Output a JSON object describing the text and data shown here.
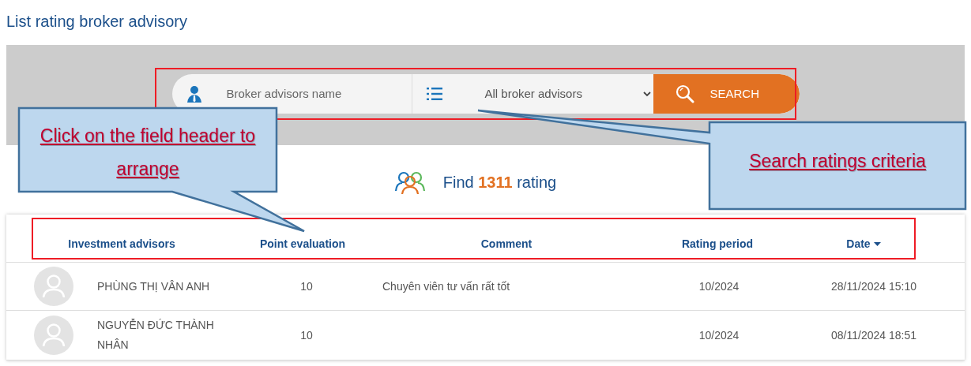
{
  "title": "List rating broker advisory",
  "search": {
    "name_placeholder": "Broker advisors name",
    "filter_value": "All broker advisors",
    "button": "SEARCH"
  },
  "summary": {
    "prefix": "Find",
    "count": "1311",
    "suffix": "rating"
  },
  "table": {
    "columns": [
      {
        "label": "Investment advisors",
        "sorted": false
      },
      {
        "label": "Point evaluation",
        "sorted": false
      },
      {
        "label": "Comment",
        "sorted": false
      },
      {
        "label": "Rating period",
        "sorted": false
      },
      {
        "label": "Date",
        "sorted": true
      }
    ],
    "rows": [
      {
        "name": "PHÙNG THỊ VÂN ANH",
        "point": "10",
        "comment": "Chuyên viên tư vấn rất tốt",
        "period": "10/2024",
        "date": "28/11/2024 15:10"
      },
      {
        "name": "NGUYỄN ĐỨC THÀNH NHÂN",
        "point": "10",
        "period": "10/2024",
        "date": "08/11/2024 18:51"
      }
    ]
  },
  "annotations": [
    {
      "kind": "header",
      "text": "Click on the field header to arrange"
    },
    {
      "kind": "search",
      "text": "Search ratings criteria"
    }
  ]
}
